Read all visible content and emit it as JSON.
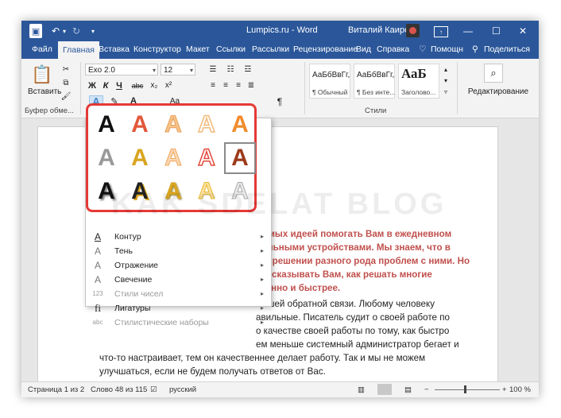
{
  "window": {
    "title": "Lumpics.ru  -  Word",
    "user": "Виталий Каиров"
  },
  "menu_tabs": [
    "Файл",
    "Главная",
    "Вставка",
    "Конструктор",
    "Макет",
    "Ссылки",
    "Рассылки",
    "Рецензирование",
    "Вид",
    "Справка",
    "Помощн",
    "Поделиться"
  ],
  "ribbon": {
    "paste_label": "Вставить",
    "clipboard_label": "Буфер обме...",
    "font_name": "Exo 2.0",
    "font_size": "12",
    "bold": "Ж",
    "italic": "К",
    "underline": "Ч",
    "strike": "abc",
    "subscript": "x₂",
    "superscript": "x²",
    "styles_label": "Стили",
    "styles": [
      {
        "sample": "АаБбВвГг,",
        "name": "¶ Обычный"
      },
      {
        "sample": "АаБбВвГг,",
        "name": "¶ Без инте..."
      },
      {
        "sample": "АаБ",
        "name": "Заголово..."
      }
    ],
    "editing_label": "Редактирование"
  },
  "text_effects_menu": {
    "items": [
      {
        "label": "Контур",
        "icon": "A",
        "disabled": false
      },
      {
        "label": "Тень",
        "icon": "A",
        "disabled": false
      },
      {
        "label": "Отражение",
        "icon": "A",
        "disabled": false
      },
      {
        "label": "Свечение",
        "icon": "A",
        "disabled": false
      },
      {
        "label": "Стили чисел",
        "icon": "123",
        "disabled": true
      },
      {
        "label": "Лигатуры",
        "icon": "fi",
        "disabled": false
      },
      {
        "label": "Стилистические наборы",
        "icon": "abc",
        "disabled": true
      }
    ],
    "gallery_glyph": "A"
  },
  "document": {
    "lines": [
      {
        "text": "жимых идеей помогать Вам в ежедневном",
        "style": "red"
      },
      {
        "text": "бильными устройствами. Мы знаем, что в",
        "style": "red"
      },
      {
        "text": "и о решении разного рода проблем с ними. Но",
        "style": "red"
      },
      {
        "text": "рассказывать Вам, как решать многие",
        "style": "red"
      },
      {
        "text": "твенно и быстрее.",
        "style": "red"
      },
      {
        "text": "Вашей обратной связи. Любому человеку",
        "style": "normal"
      },
      {
        "text": "авильные. Писатель судит о своей работе по",
        "style": "normal"
      },
      {
        "text": "о качестве своей работы по тому, как быстро",
        "style": "normal"
      },
      {
        "text": "ем меньше системный администратор бегает и",
        "style": "normal"
      },
      {
        "text": "что-то настраивает, тем он качественнее делает работу. Так и мы не можем",
        "style": "normal"
      },
      {
        "text": "улучшаться, если не будем получать ответов от Вас.",
        "style": "normal"
      }
    ],
    "watermark": "KAK SDELAT BLOG"
  },
  "status": {
    "page": "Страница 1 из 2",
    "words": "Слово 48 из 115",
    "language": "русский",
    "zoom": "100 %"
  }
}
